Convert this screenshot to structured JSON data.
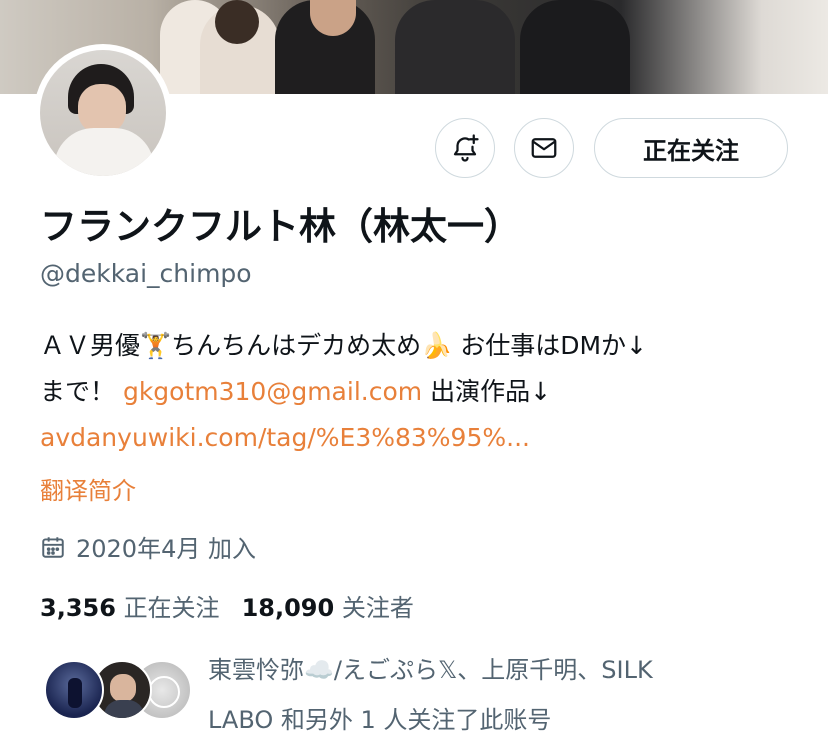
{
  "profile": {
    "display_name": "フランクフルト林（林太一）",
    "handle": "@dekkai_chimpo",
    "bio_line1": "ＡＶ男優🏋️ちんちんはデカめ太め🍌 お仕事はDMか↓",
    "bio_line2_prefix": "まで！ ",
    "bio_email": "gkgotm310@gmail.com",
    "bio_line2_suffix": " 出演作品↓",
    "bio_url": "avdanyuwiki.com/tag/%E3%83%95%...",
    "translate_label": "翻译简介",
    "joined": "2020年4月 加入"
  },
  "actions": {
    "notify_icon": "bell-plus-icon",
    "message_icon": "mail-icon",
    "follow_label": "正在关注"
  },
  "stats": {
    "following_count": "3,356",
    "following_label": "正在关注",
    "followers_count": "18,090",
    "followers_label": "关注者"
  },
  "followed_by": {
    "line1": "東雲怜弥☁️/えごぷら𝕏、上原千明、SILK",
    "line2": "LABO 和另外 1 人关注了此账号"
  },
  "colors": {
    "accent": "#e8803a",
    "text": "#0f1419",
    "secondary": "#536471",
    "border": "#cfd9de"
  }
}
